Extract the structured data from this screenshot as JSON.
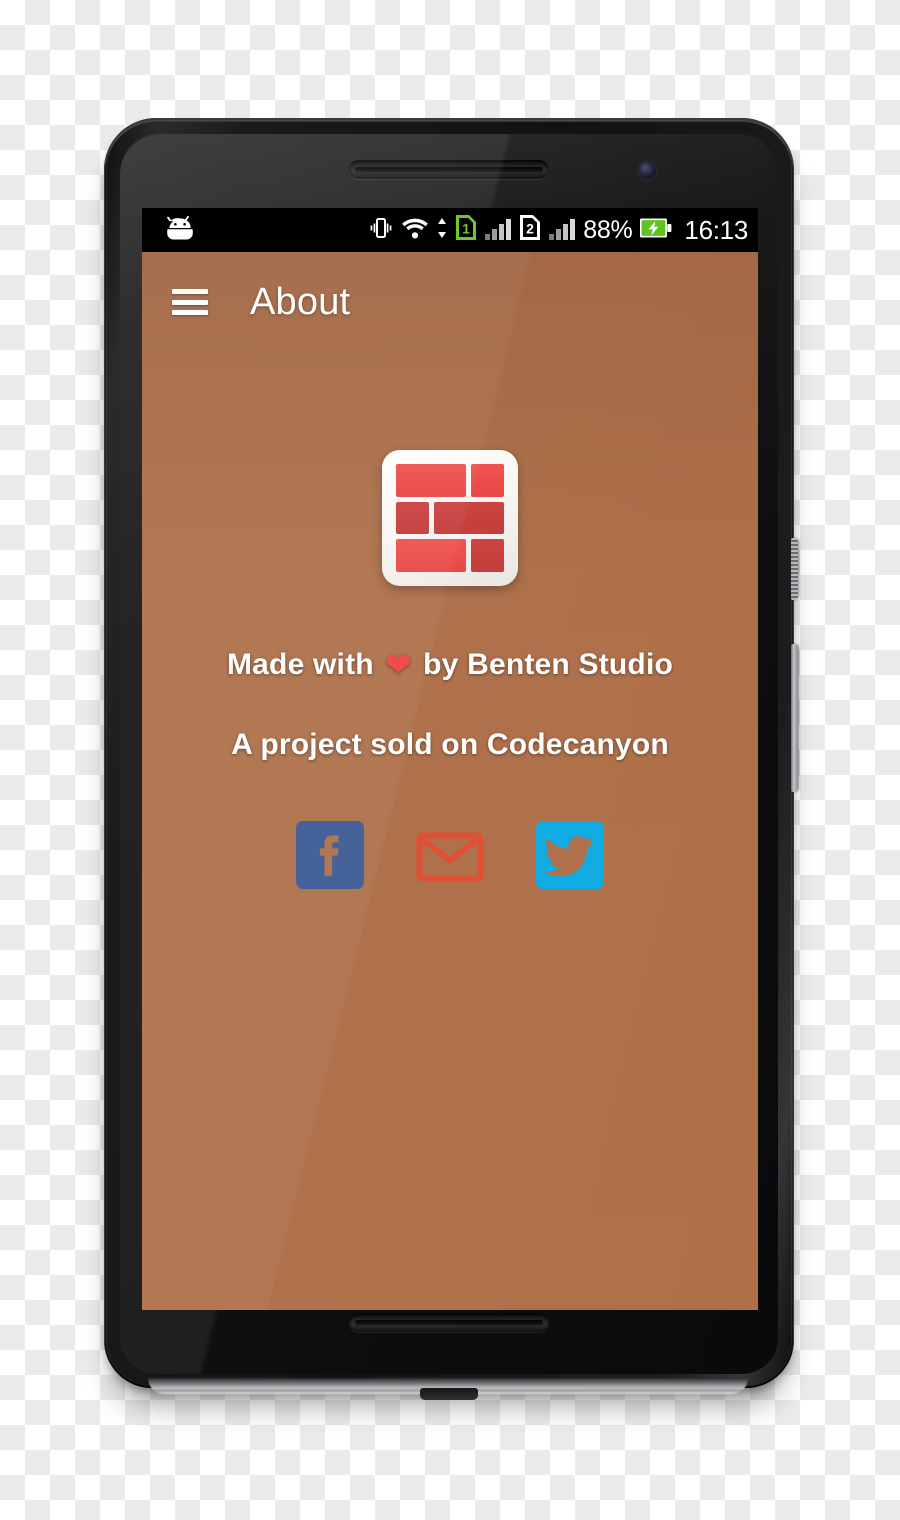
{
  "device": {
    "name": "android-smartphone",
    "earpiece": "earpiece-speaker",
    "camera": "front-camera",
    "volume": "volume-rocker",
    "power": "power-button"
  },
  "statusbar": {
    "android_icon": "android-robot-icon",
    "vibrate_icon": "vibrate-mode-icon",
    "wifi_icon": "wifi-icon",
    "data_transfer_icon": "data-updown-arrows-icon",
    "sim1_label": "1",
    "sim1_color": "#6fc82a",
    "sim1_signal_icon": "signal-bars-icon",
    "sim2_label": "2",
    "sim2_color": "#ffffff",
    "sim2_signal_icon": "signal-bars-icon",
    "battery_percent": "88%",
    "battery_icon": "battery-charging-icon",
    "battery_color": "#5fc321",
    "clock": "16:13"
  },
  "toolbar": {
    "menu_icon": "hamburger-menu-icon",
    "title": "About"
  },
  "about": {
    "logo_icon": "brick-wall-app-logo",
    "logo_colors": {
      "light_brick": "#ee4b49",
      "dark_brick": "#c93a3a",
      "frame": "#ffffff"
    },
    "credit_prefix": "Made with",
    "heart_icon": "heart-icon",
    "heart_color": "#f1413f",
    "credit_suffix": "by Benten Studio",
    "project_line": "A project sold on Codecanyon"
  },
  "social": [
    {
      "name": "facebook",
      "icon": "facebook-icon",
      "label": "Facebook",
      "color": "#3b5a93"
    },
    {
      "name": "email",
      "icon": "email-envelope-icon",
      "label": "Email",
      "color": "#e04e32"
    },
    {
      "name": "twitter",
      "icon": "twitter-bird-icon",
      "label": "Twitter",
      "color": "#0fabe3"
    }
  ],
  "background": {
    "image": "blurred-brick-wall",
    "brick_color": "#c2784f",
    "mortar_color": "#e9dcc2"
  }
}
